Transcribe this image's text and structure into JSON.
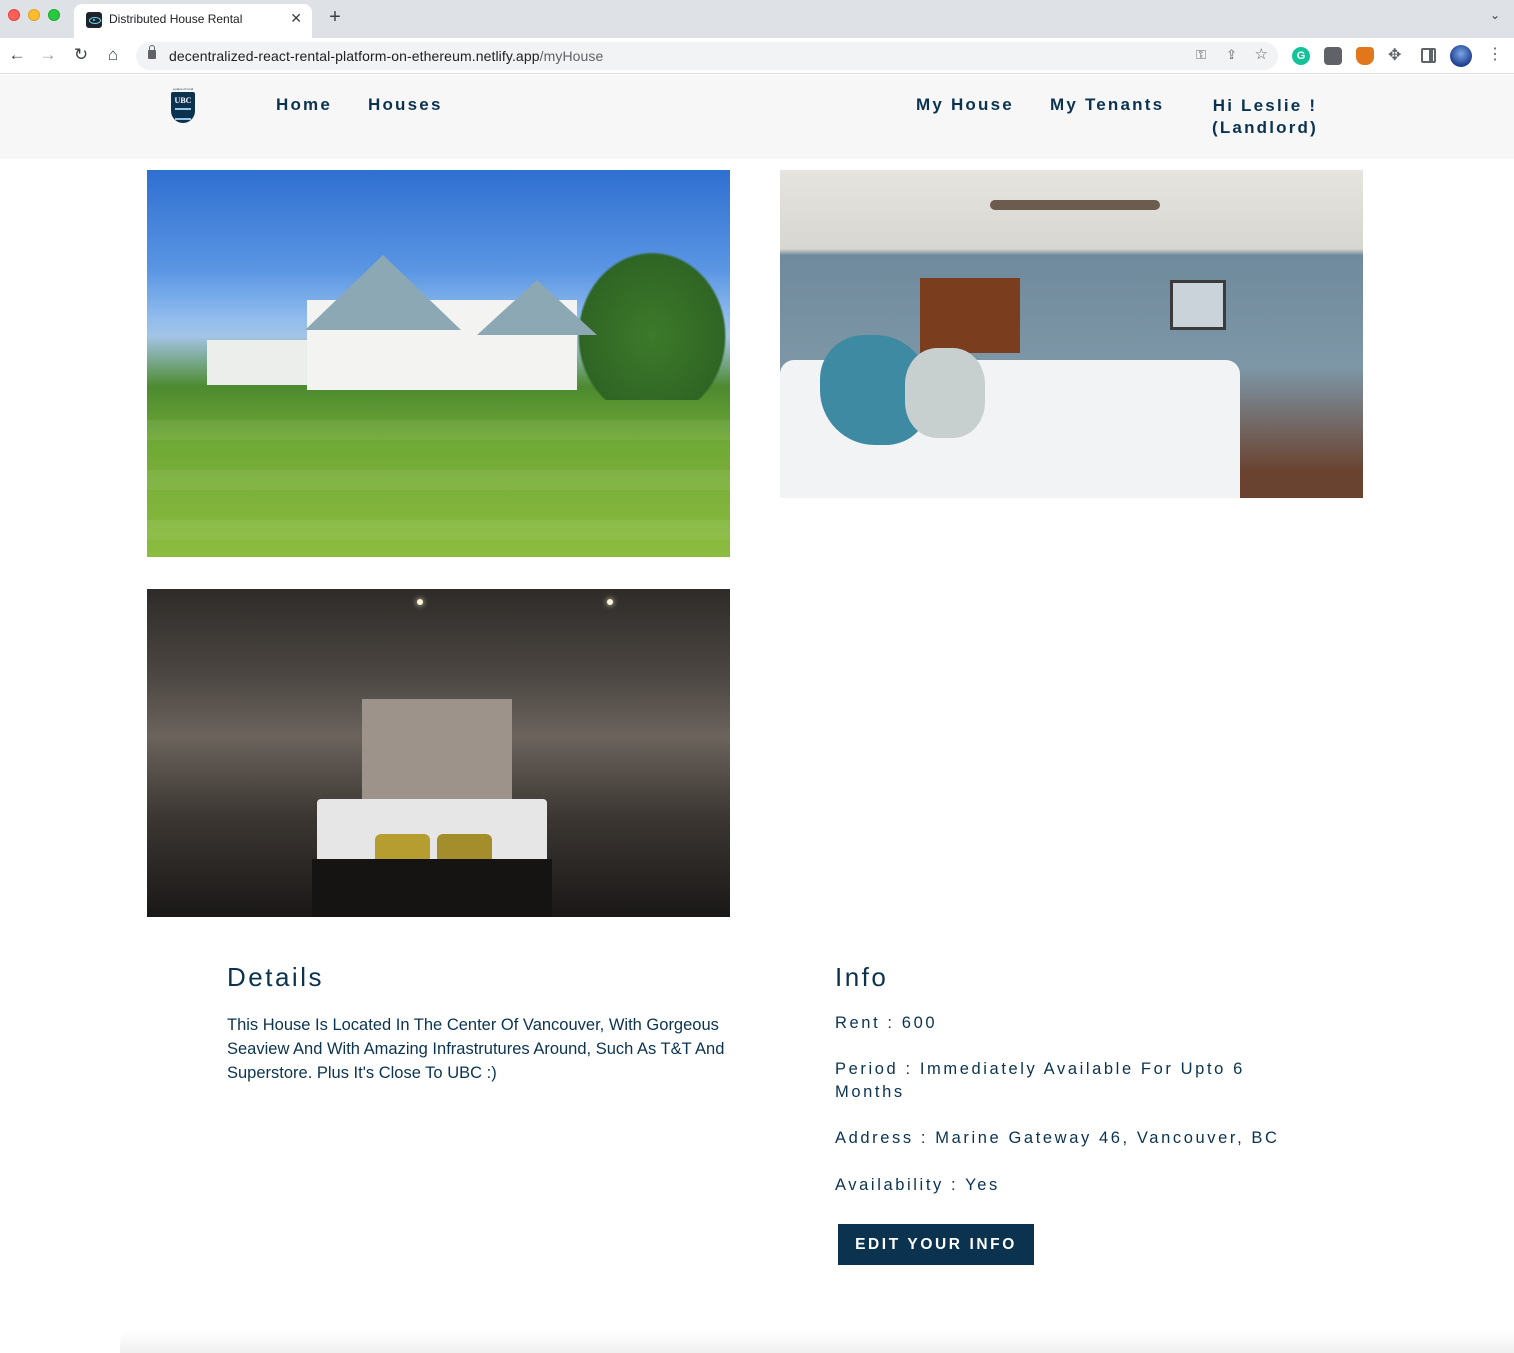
{
  "browser": {
    "tab_title": "Distributed House Rental",
    "tab_close": "✕",
    "new_tab": "+",
    "url_host": "decentralized-react-rental-platform-on-ethereum.netlify.app",
    "url_path": "/myHouse",
    "icons": [
      "back-icon",
      "forward-icon",
      "reload-icon",
      "home-icon",
      "lock-icon",
      "key-icon",
      "share-icon",
      "star-icon",
      "grammarly-icon",
      "extension-icon",
      "metamask-icon",
      "puzzle-icon",
      "side-panel-icon",
      "profile-avatar",
      "menu-icon"
    ]
  },
  "nav": {
    "logo_tagline": "a place of mind",
    "logo_text": "UBC",
    "links": {
      "home": "Home",
      "houses": "Houses",
      "my_house": "My House",
      "my_tenants": "My Tenants",
      "greeting": "Hi Leslie !",
      "role": "(Landlord)"
    }
  },
  "gallery": {
    "images": [
      "house-exterior-photo",
      "bedroom-photo",
      "dark-bedroom-photo"
    ]
  },
  "details": {
    "title": "Details",
    "description": "This House Is Located In The Center Of Vancouver, With Gorgeous Seaview And With Amazing Infrastrutures Around, Such As T&T And Superstore. Plus It's Close To UBC :)"
  },
  "info": {
    "title": "Info",
    "rent": "Rent : 600",
    "period": "Period : Immediately Available For Upto 6 Months",
    "address": "Address : Marine Gateway 46, Vancouver, BC",
    "availability": "Availability : Yes",
    "edit_button": "EDIT YOUR INFO"
  },
  "colors": {
    "primary": "#0b3350",
    "navbar_bg": "#f7f7f7",
    "page_bg": "#ffffff"
  }
}
